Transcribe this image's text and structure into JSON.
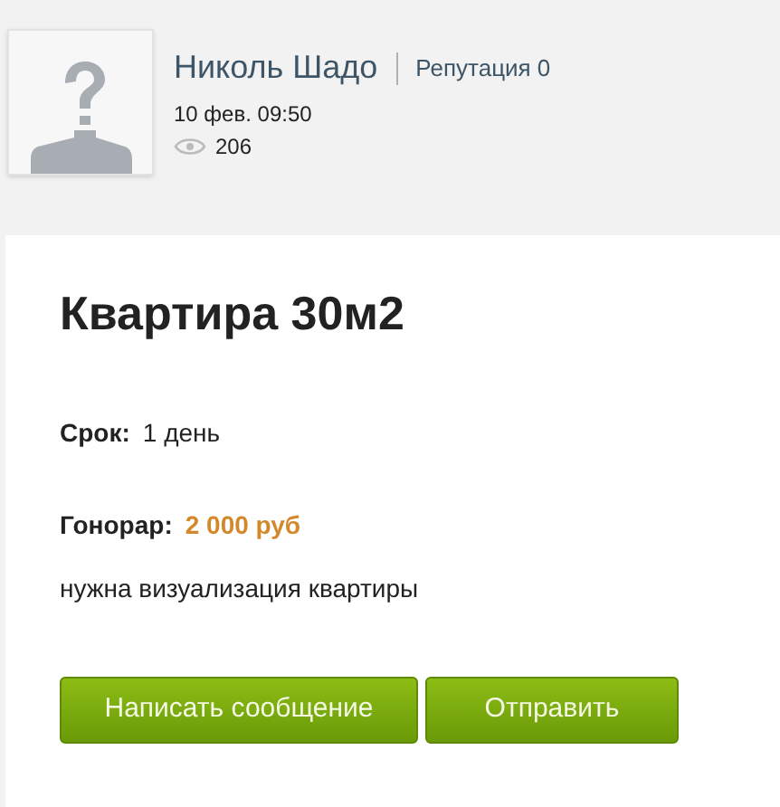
{
  "author": {
    "name": "Николь Шадо",
    "reputation": "Репутация 0",
    "date": "10 фев. 09:50",
    "views": "206"
  },
  "task": {
    "title": "Квартира 30м2",
    "fields": [
      {
        "label": "Срок:",
        "value": "1 день",
        "kind": "plain"
      },
      {
        "label": "Гонорар:",
        "value": "2 000 руб",
        "kind": "price"
      }
    ],
    "description": "нужна визуализация квартиры"
  },
  "buttons": [
    "Написать сообщение",
    "Отправить"
  ]
}
